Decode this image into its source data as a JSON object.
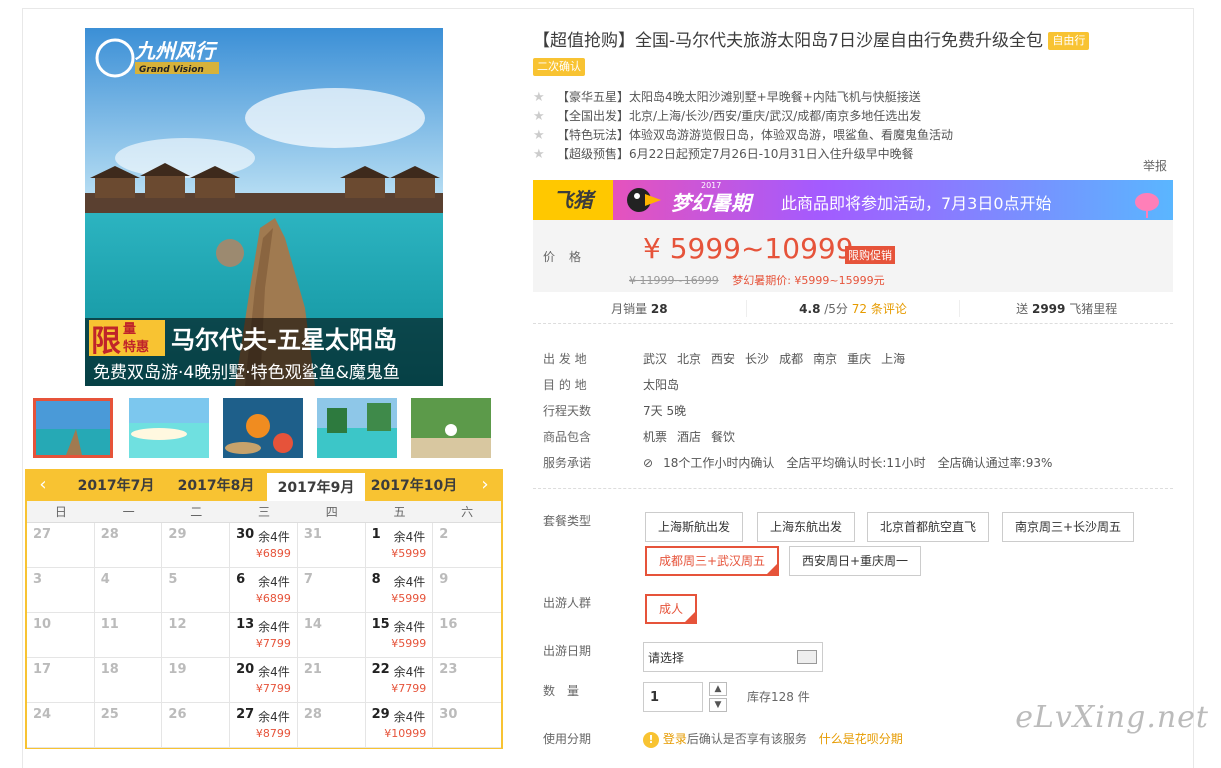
{
  "gallery": {
    "logo": "九州风行",
    "logo_sub": "Grand Vision",
    "promo_a": "限",
    "promo_b": "量",
    "promo_c": "特惠",
    "headline": "马尔代夫-五星太阳岛",
    "subline": "免费双岛游·4晚别墅·特色观鲨鱼&魔鬼鱼"
  },
  "calendar": {
    "months": [
      "2017年7月",
      "2017年8月",
      "2017年9月",
      "2017年10月"
    ],
    "selected_month": "2017年9月",
    "weekdays": [
      "日",
      "一",
      "二",
      "三",
      "四",
      "五",
      "六"
    ],
    "cells": [
      {
        "d": "27"
      },
      {
        "d": "28"
      },
      {
        "d": "29"
      },
      {
        "d": "30",
        "s": "余4件",
        "p": "¥6899"
      },
      {
        "d": "31"
      },
      {
        "d": "1",
        "s": "余4件",
        "p": "¥5999"
      },
      {
        "d": "2"
      },
      {
        "d": "3"
      },
      {
        "d": "4"
      },
      {
        "d": "5"
      },
      {
        "d": "6",
        "s": "余4件",
        "p": "¥6899"
      },
      {
        "d": "7"
      },
      {
        "d": "8",
        "s": "余4件",
        "p": "¥5999"
      },
      {
        "d": "9"
      },
      {
        "d": "10"
      },
      {
        "d": "11"
      },
      {
        "d": "12"
      },
      {
        "d": "13",
        "s": "余4件",
        "p": "¥7799"
      },
      {
        "d": "14"
      },
      {
        "d": "15",
        "s": "余4件",
        "p": "¥5999"
      },
      {
        "d": "16"
      },
      {
        "d": "17"
      },
      {
        "d": "18"
      },
      {
        "d": "19"
      },
      {
        "d": "20",
        "s": "余4件",
        "p": "¥7799"
      },
      {
        "d": "21"
      },
      {
        "d": "22",
        "s": "余4件",
        "p": "¥7799"
      },
      {
        "d": "23"
      },
      {
        "d": "24"
      },
      {
        "d": "25"
      },
      {
        "d": "26"
      },
      {
        "d": "27",
        "s": "余4件",
        "p": "¥8799"
      },
      {
        "d": "28"
      },
      {
        "d": "29",
        "s": "余4件",
        "p": "¥10999"
      },
      {
        "d": "30"
      }
    ]
  },
  "product": {
    "title": "【超值抢购】全国-马尔代夫旅游太阳岛7日沙屋自由行免费升级全包",
    "tag1": "自由行",
    "tag2": "二次确认",
    "features": [
      "【豪华五星】太阳岛4晚太阳沙滩别墅+早晚餐+内陆飞机与快艇接送",
      "【全国出发】北京/上海/长沙/西安/重庆/武汉/成都/南京多地任选出发",
      "【特色玩法】体验双岛游游览假日岛，体验双岛游，喂鲨鱼、看魔鬼鱼活动",
      "【超级预售】6月22日起预定7月26日-10月31日入住升级早中晚餐"
    ],
    "report": "举报"
  },
  "banner": {
    "brand": "飞猪",
    "event": "梦幻暑期",
    "year": "2017",
    "text": "此商品即将参加活动，7月3日0点开始"
  },
  "price": {
    "label": "价格",
    "value": "¥ 5999~10999",
    "promo": "限购促销",
    "orig": "¥ 11999~16999",
    "dream": "梦幻暑期价: ¥5999~15999元"
  },
  "stats": {
    "sales_label": "月销量",
    "sales": "28",
    "rating": "4.8",
    "rating_suffix": "/5分",
    "reviews": "72 条评论",
    "miles_prefix": "送",
    "miles": "2999",
    "miles_suffix": "飞猪里程"
  },
  "info": {
    "from_label": "出 发 地",
    "from": [
      "武汉",
      "北京",
      "西安",
      "长沙",
      "成都",
      "南京",
      "重庆",
      "上海"
    ],
    "dest_label": "目 的 地",
    "dest": "太阳岛",
    "days_label": "行程天数",
    "days": "7天 5晚",
    "incl_label": "商品包含",
    "incl": [
      "机票",
      "酒店",
      "餐饮"
    ],
    "promise_label": "服务承诺",
    "promise": "18个工作小时内确认　全店平均确认时长:11小时　全店确认通过率:93%"
  },
  "options": {
    "pkg_label": "套餐类型",
    "packages": [
      "上海斯航出发",
      "上海东航出发",
      "北京首都航空直飞",
      "南京周三+长沙周五",
      "成都周三+武汉周五",
      "西安周日+重庆周一"
    ],
    "crowd_label": "出游人群",
    "crowd": "成人",
    "date_label": "出游日期",
    "date_placeholder": "请选择",
    "qty_label": "数　量",
    "qty": "1",
    "stock": "库存128 件",
    "install_label": "使用分期",
    "install_login": "登录",
    "install_text": "后确认是否享有该服务",
    "install_link": "什么是花呗分期"
  },
  "watermark": "eLvXing.net",
  "colors": {
    "accent": "#e6533a",
    "yellow": "#f8c332"
  }
}
